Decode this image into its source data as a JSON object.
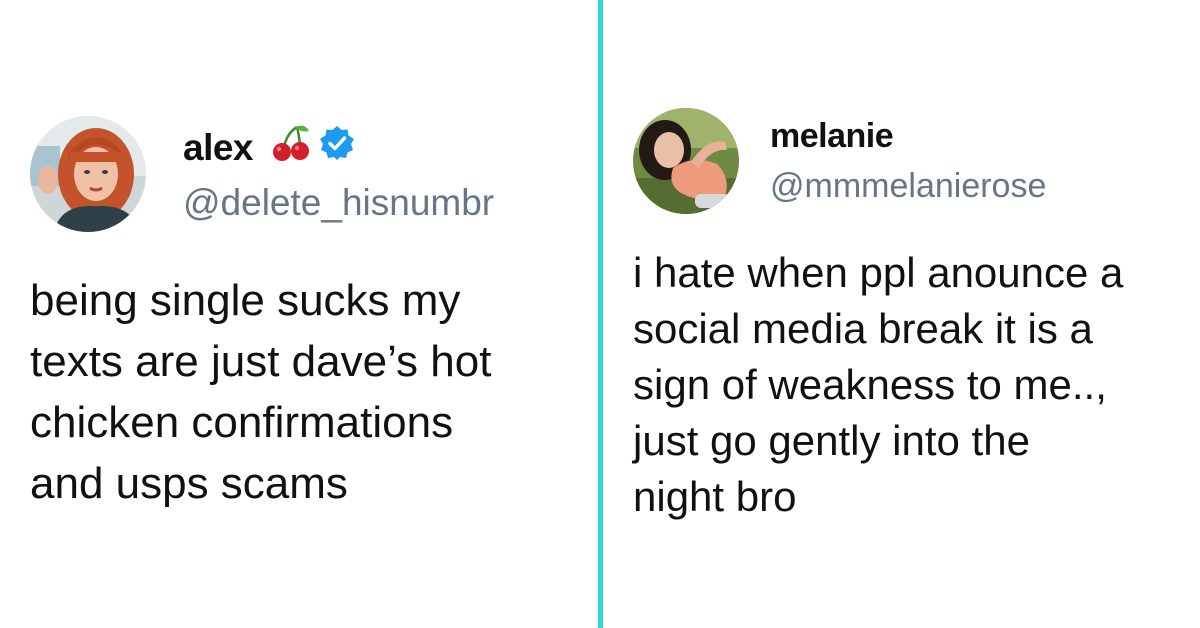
{
  "tweets": [
    {
      "display_name": "alex",
      "handle": "@delete_hisnumbr",
      "name_emoji_icon": "cherries-icon",
      "verified_icon": "verified-badge-icon",
      "verified_color": "#1d9bf0",
      "text_lines": [
        "being single sucks my",
        "texts are just dave’s hot",
        "chicken confirmations",
        "and usps scams"
      ]
    },
    {
      "display_name": "melanie",
      "handle": "@mmmelanierose",
      "text_lines": [
        "i hate when ppl anounce a",
        "social media break it is a",
        "sign of weakness to me..,",
        "just go gently into the",
        "night bro"
      ]
    }
  ],
  "divider_color": "#2fd6e3"
}
